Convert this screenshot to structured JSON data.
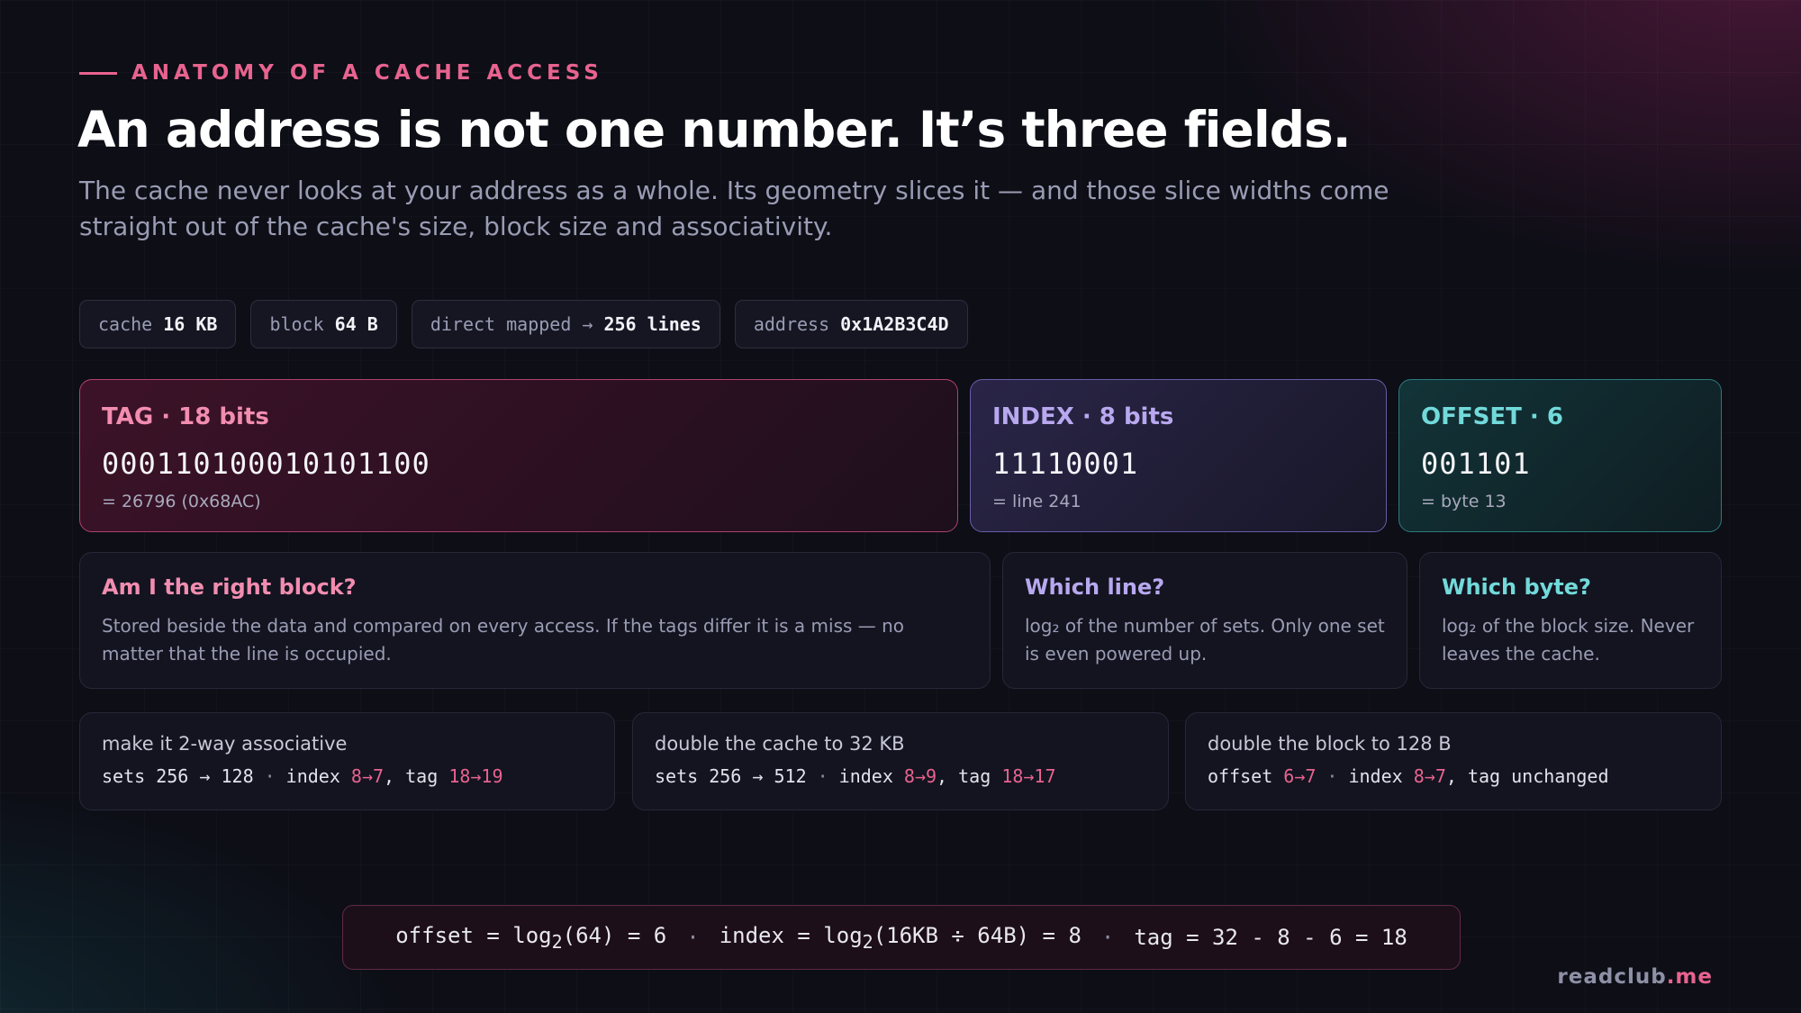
{
  "eyebrow": "ANATOMY OF A CACHE ACCESS",
  "title": "An address is not one number. It’s three fields.",
  "subtitle": "The cache never looks at your address as a whole. Its geometry slices it — and those slice widths come straight out of the cache's size, block size and associativity.",
  "chips": [
    {
      "key": "cache",
      "value": "16 KB"
    },
    {
      "key": "block",
      "value": "64 B"
    },
    {
      "key": "direct mapped →",
      "value": "256 lines"
    },
    {
      "key": "address",
      "value": "0x1A2B3C4D"
    }
  ],
  "fields": {
    "tag": {
      "label": "TAG · 18 bits",
      "bits": "000110100010101100",
      "note": "= 26796 (0x68AC)"
    },
    "index": {
      "label": "INDEX · 8 bits",
      "bits": "11110001",
      "note": "= line 241"
    },
    "offset": {
      "label": "OFFSET · 6",
      "bits": "001101",
      "note": "= byte 13"
    }
  },
  "explain": {
    "tag": {
      "title": "Am I the right block?",
      "body": "Stored beside the data and compared on every access. If the tags differ it is a miss — no matter that the line is occupied."
    },
    "index": {
      "title": "Which line?",
      "body": "log₂ of the number of sets. Only one set is even powered up."
    },
    "offset": {
      "title": "Which byte?",
      "body": "log₂ of the block size. Never leaves the cache."
    }
  },
  "scenarios": [
    {
      "title": "make it 2-way associative",
      "a_label": "sets",
      "a_from": "256",
      "a_to": "128",
      "b_label": "index",
      "b_change": "8→7",
      "c_label": "tag",
      "c_change": "18→19"
    },
    {
      "title": "double the cache to 32 KB",
      "a_label": "sets",
      "a_from": "256",
      "a_to": "512",
      "b_label": "index",
      "b_change": "8→9",
      "c_label": "tag",
      "c_change": "18→17"
    },
    {
      "title": "double the block to 128 B",
      "a_label": "offset",
      "a_change": "6→7",
      "b_label": "index",
      "b_change": "8→7",
      "c_label": "tag",
      "c_value": "unchanged"
    }
  ],
  "formula": {
    "offset_lhs": "offset = log",
    "offset_rhs": "(64) = 6",
    "index_lhs": "index = log",
    "index_rhs": "(16KB ÷ 64B) = 8",
    "tag": "tag = 32 - 8 - 6 = 18",
    "sub": "2",
    "separator": "·"
  },
  "brand": {
    "name": "readclub",
    "tld": ".me"
  },
  "colors": {
    "accent": "#e8638f",
    "tag": "#f28db0",
    "index": "#b8a8ef",
    "offset": "#72dada",
    "background": "#0d0e16"
  }
}
